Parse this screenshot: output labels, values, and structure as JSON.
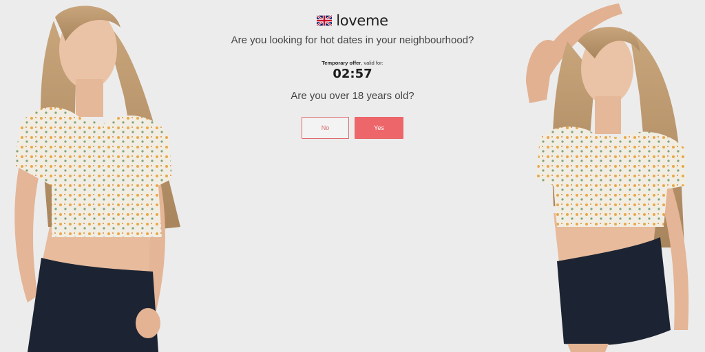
{
  "brand": {
    "name": "loveme",
    "flag_icon": "uk-flag-icon"
  },
  "headline": "Are you looking for hot dates in your neighbourhood?",
  "offer": {
    "label_bold": "Temporary offer",
    "label_rest": ", valid for:",
    "countdown": "02:57"
  },
  "age_question": "Are you over 18 years old?",
  "buttons": {
    "no_label": "No",
    "yes_label": "Yes"
  },
  "colors": {
    "background": "#ececec",
    "accent": "#ec666a"
  }
}
